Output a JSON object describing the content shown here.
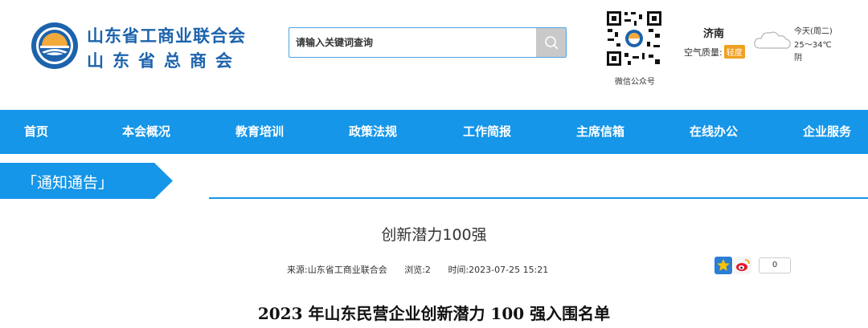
{
  "header": {
    "org_name_line1": "山东省工商业联合会",
    "org_name_line2": "山东省总商会",
    "search_placeholder": "请输入关键词查询",
    "qr_label": "微信公众号",
    "weather": {
      "city": "济南",
      "air_quality_label": "空气质量:",
      "air_quality_value": "轻度",
      "day": "今天(周二)",
      "temperature": "25～34℃",
      "condition": "阴"
    }
  },
  "nav": {
    "items": [
      "首页",
      "本会概况",
      "教育培训",
      "政策法规",
      "工作简报",
      "主席信箱",
      "在线办公",
      "企业服务"
    ]
  },
  "section": {
    "label": "「通知通告」"
  },
  "article": {
    "title": "创新潜力100强",
    "source": "来源:山东省工商业联合会",
    "views": "浏览:2",
    "time": "时间:2023-07-25 15:21",
    "share_count": "0",
    "body_heading": "2023 年山东民营企业创新潜力 100 强入围名单"
  },
  "colors": {
    "brand_blue": "#1596e8",
    "title_blue": "#1c63ac",
    "aq_badge": "#f0a020"
  },
  "icons": [
    "emblem-logo",
    "search-icon",
    "qr-code",
    "cloud-icon",
    "favorite-star-icon",
    "weibo-icon"
  ]
}
